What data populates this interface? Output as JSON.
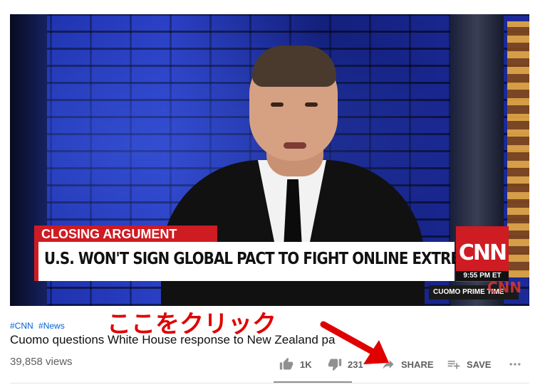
{
  "video": {
    "lower_third": {
      "label": "CLOSING ARGUMENT",
      "headline": "U.S. WON'T SIGN GLOBAL PACT TO FIGHT ONLINE EXTREMISM"
    },
    "network_logo": "CNN",
    "clock": "9:55 PM ET",
    "show_name": "CUOMO PRIME TIME",
    "watermark": "CNN"
  },
  "info": {
    "hashtags": [
      "#CNN",
      "#News"
    ],
    "title": "Cuomo questions White House response to New Zealand pa",
    "views": "39,858 views"
  },
  "actions": {
    "like_count": "1K",
    "dislike_count": "231",
    "share_label": "SHARE",
    "save_label": "SAVE"
  },
  "annotation": {
    "text": "ここをクリック",
    "color": "#e00000"
  },
  "icons": {
    "like": "thumbs-up-icon",
    "dislike": "thumbs-down-icon",
    "share": "share-arrow-icon",
    "save": "playlist-add-icon",
    "more": "more-horizontal-icon"
  }
}
